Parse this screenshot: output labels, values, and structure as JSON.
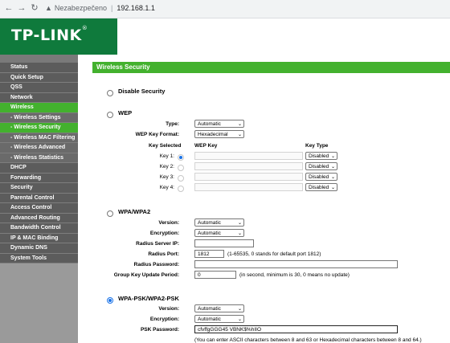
{
  "browser": {
    "security_label": "Nezabezpečeno",
    "url": "192.168.1.1"
  },
  "header": {
    "logo": "TP-LINK",
    "logo_mark": "®"
  },
  "sidebar": {
    "items": [
      {
        "label": "Status"
      },
      {
        "label": "Quick Setup"
      },
      {
        "label": "QSS"
      },
      {
        "label": "Network"
      },
      {
        "label": "Wireless"
      },
      {
        "label": "- Wireless Settings"
      },
      {
        "label": "- Wireless Security"
      },
      {
        "label": "- Wireless MAC Filtering"
      },
      {
        "label": "- Wireless Advanced"
      },
      {
        "label": "- Wireless Statistics"
      },
      {
        "label": "DHCP"
      },
      {
        "label": "Forwarding"
      },
      {
        "label": "Security"
      },
      {
        "label": "Parental Control"
      },
      {
        "label": "Access Control"
      },
      {
        "label": "Advanced Routing"
      },
      {
        "label": "Bandwidth Control"
      },
      {
        "label": "IP & MAC Binding"
      },
      {
        "label": "Dynamic DNS"
      },
      {
        "label": "System Tools"
      }
    ]
  },
  "main": {
    "title": "Wireless Security",
    "disable_security": "Disable Security",
    "wep": {
      "label": "WEP",
      "type_label": "Type:",
      "type_value": "Automatic",
      "format_label": "WEP Key Format:",
      "format_value": "Hexadecimal",
      "col_key_selected": "Key Selected",
      "col_wep_key": "WEP Key",
      "col_key_type": "Key Type",
      "keys": [
        {
          "label": "Key 1:",
          "type": "Disabled"
        },
        {
          "label": "Key 2:",
          "type": "Disabled"
        },
        {
          "label": "Key 3:",
          "type": "Disabled"
        },
        {
          "label": "Key 4:",
          "type": "Disabled"
        }
      ]
    },
    "wpa": {
      "label": "WPA/WPA2",
      "version_label": "Version:",
      "version_value": "Automatic",
      "encryption_label": "Encryption:",
      "encryption_value": "Automatic",
      "radius_ip_label": "Radius Server IP:",
      "radius_ip_value": "",
      "radius_port_label": "Radius Port:",
      "radius_port_value": "1812",
      "radius_port_note": "(1-65535, 0 stands for default port 1812)",
      "radius_pwd_label": "Radius Password:",
      "radius_pwd_value": "",
      "group_key_label": "Group Key Update Period:",
      "group_key_value": "0",
      "group_key_note": "(in second, minimum is 30, 0 means no update)"
    },
    "psk": {
      "label": "WPA-PSK/WPA2-PSK",
      "version_label": "Version:",
      "version_value": "Automatic",
      "encryption_label": "Encryption:",
      "encryption_value": "Automatic",
      "password_label": "PSK Password:",
      "password_value": "cfvffgGGG45 VBNK$%hIIO",
      "password_note": "(You can enter ASCII characters between 8 and 63 or Hexadecimal characters between 8 and 64.)"
    }
  }
}
